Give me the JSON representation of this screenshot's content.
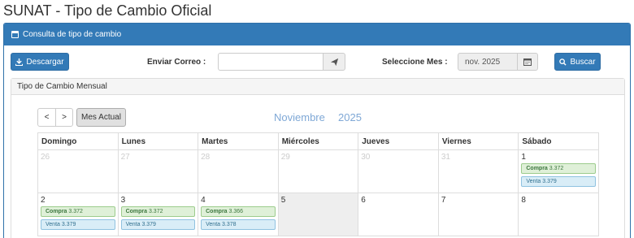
{
  "page_title": "SUNAT - Tipo de Cambio Oficial",
  "panel_heading": "Consulta de tipo de cambio",
  "toolbar": {
    "download_label": "Descargar",
    "email_label": "Enviar Correo :",
    "email_value": "",
    "month_label": "Seleccione Mes :",
    "month_value": "nov. 2025",
    "search_label": "Buscar"
  },
  "monthly_heading": "Tipo de Cambio Mensual",
  "calendar_nav": {
    "prev": "<",
    "next": ">",
    "current": "Mes Actual",
    "month_name": "Noviembre",
    "year": "2025"
  },
  "weekdays": [
    "Domingo",
    "Lunes",
    "Martes",
    "Miércoles",
    "Jueves",
    "Viernes",
    "Sábado"
  ],
  "weeks": [
    [
      {
        "day": "26",
        "other": true
      },
      {
        "day": "27",
        "other": true
      },
      {
        "day": "28",
        "other": true
      },
      {
        "day": "29",
        "other": true
      },
      {
        "day": "30",
        "other": true
      },
      {
        "day": "31",
        "other": true
      },
      {
        "day": "1",
        "compra": "3.372",
        "venta": "3.379"
      }
    ],
    [
      {
        "day": "2",
        "compra": "3.372",
        "venta": "3.379"
      },
      {
        "day": "3",
        "compra": "3.372",
        "venta": "3.379"
      },
      {
        "day": "4",
        "compra": "3.366",
        "venta": "3.378"
      },
      {
        "day": "5",
        "gray": true
      },
      {
        "day": "6"
      },
      {
        "day": "7"
      },
      {
        "day": "8"
      }
    ]
  ],
  "labels": {
    "compra": "Compra",
    "venta": "Venta"
  }
}
